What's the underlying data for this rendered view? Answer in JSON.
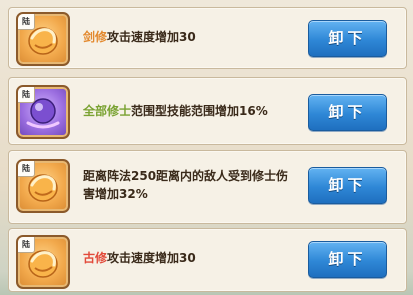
{
  "items": [
    {
      "tag": "陆",
      "icon": "gold-egg-icon",
      "highlight": "剑修",
      "highlight_color": "#e3892e",
      "description": "攻击速度增加30",
      "button": "卸下"
    },
    {
      "tag": "陆",
      "icon": "purple-orb-icon",
      "highlight": "全部修士",
      "highlight_color": "#7aa232",
      "description": "范围型技能范围增加16%",
      "button": "卸下"
    },
    {
      "tag": "陆",
      "icon": "gold-egg-icon",
      "highlight": "",
      "highlight_color": "",
      "description": "距离阵法250距离内的敌人受到修士伤害增加32%",
      "button": "卸下"
    },
    {
      "tag": "陆",
      "icon": "gold-egg-icon",
      "highlight": "古修",
      "highlight_color": "#e24a3a",
      "description": "攻击速度增加30",
      "button": "卸下"
    }
  ]
}
